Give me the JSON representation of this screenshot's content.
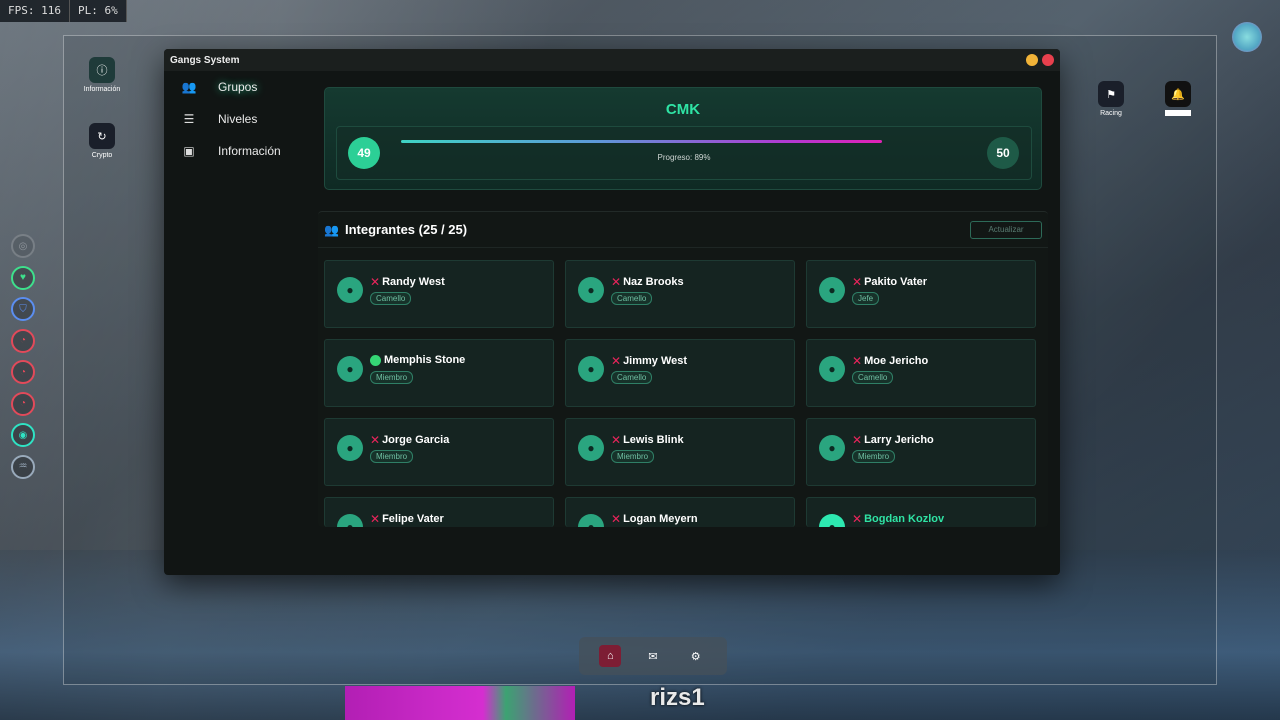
{
  "hud": {
    "fps": "FPS: 116",
    "pl": "PL: 6%"
  },
  "desktop_apps_left": [
    {
      "label": "Información",
      "icon": "info-icon"
    },
    {
      "label": "Crypto",
      "icon": "crypto-icon"
    }
  ],
  "desktop_apps_right": [
    {
      "label": "Racing",
      "icon": "flag-icon"
    },
    {
      "label": "",
      "icon": "bell-icon"
    }
  ],
  "window": {
    "title": "Gangs System"
  },
  "sidebar": {
    "items": [
      {
        "label": "Grupos",
        "icon": "users-icon",
        "active": true
      },
      {
        "label": "Niveles",
        "icon": "list-icon",
        "active": false
      },
      {
        "label": "Información",
        "icon": "folder-plus-icon",
        "active": false
      }
    ]
  },
  "gang": {
    "name": "CMK",
    "level_current": "49",
    "level_next": "50",
    "progress_text": "Progreso: 89%",
    "progress": 0.89
  },
  "members": {
    "title": "Integrantes (25 / 25)",
    "refresh_label": "Actualizar",
    "list": [
      {
        "name": "Randy West",
        "role": "Camello",
        "online": false
      },
      {
        "name": "Naz Brooks",
        "role": "Camello",
        "online": false
      },
      {
        "name": "Pakito Vater",
        "role": "Jefe",
        "online": false
      },
      {
        "name": "Memphis Stone",
        "role": "Miembro",
        "online": true
      },
      {
        "name": "Jimmy West",
        "role": "Camello",
        "online": false
      },
      {
        "name": "Moe Jericho",
        "role": "Camello",
        "online": false
      },
      {
        "name": "Jorge Garcia",
        "role": "Miembro",
        "online": false
      },
      {
        "name": "Lewis Blink",
        "role": "Miembro",
        "online": false
      },
      {
        "name": "Larry Jericho",
        "role": "Miembro",
        "online": false
      },
      {
        "name": "Felipe Vater",
        "role": "",
        "online": false
      },
      {
        "name": "Logan Meyern",
        "role": "",
        "online": false
      },
      {
        "name": "Bogdan Kozlov",
        "role": "",
        "online": false
      }
    ]
  },
  "player_name": "rizs1",
  "colors": {
    "accent": "#2fe3a4",
    "offline": "#e8245b",
    "online": "#35d675"
  }
}
